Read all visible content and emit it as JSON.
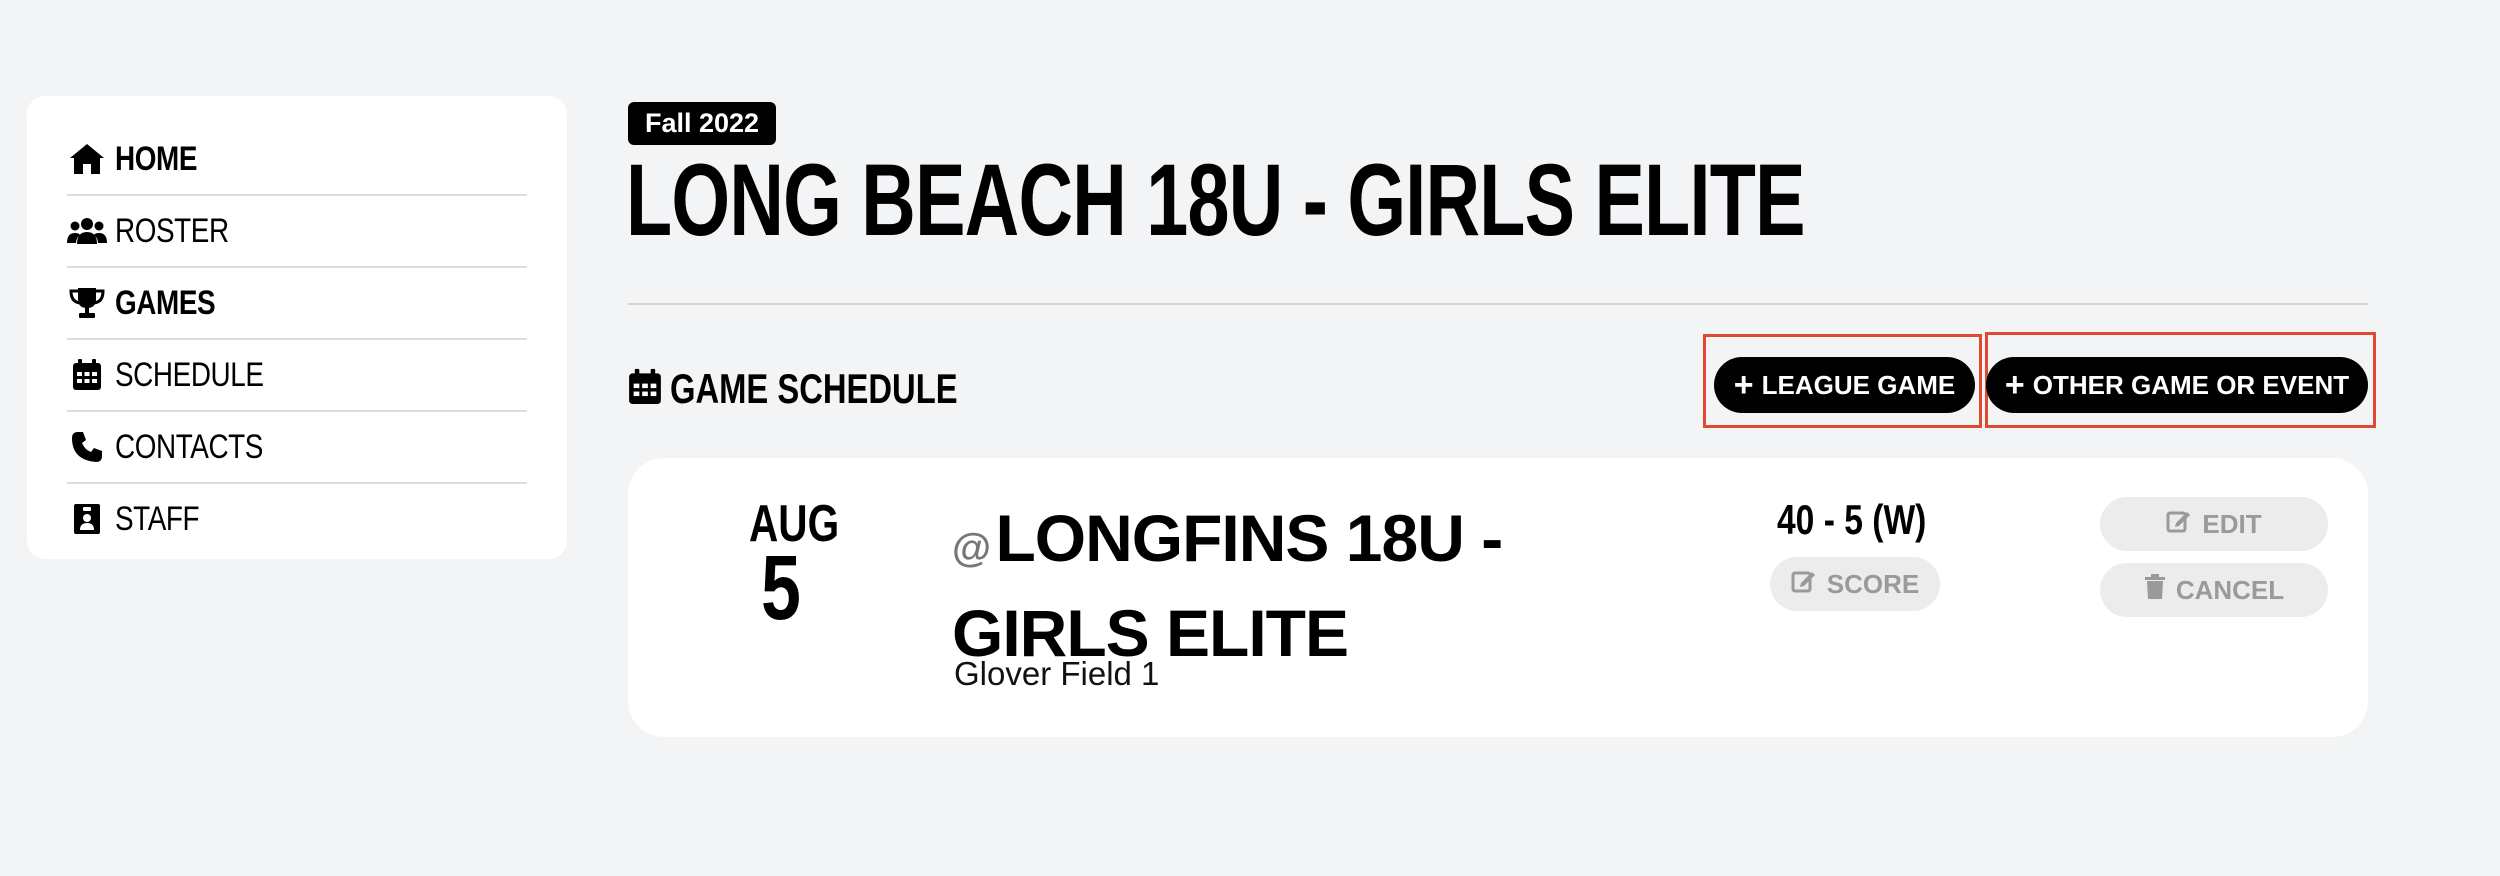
{
  "sidebar": {
    "items": [
      {
        "label": "HOME",
        "icon": "home-icon",
        "bold": true
      },
      {
        "label": "ROSTER",
        "icon": "users-icon",
        "bold": false
      },
      {
        "label": "GAMES",
        "icon": "trophy-icon",
        "bold": true
      },
      {
        "label": "SCHEDULE",
        "icon": "calendar-icon",
        "bold": false
      },
      {
        "label": "CONTACTS",
        "icon": "phone-icon",
        "bold": false
      },
      {
        "label": "STAFF",
        "icon": "id-badge-icon",
        "bold": false
      }
    ]
  },
  "header": {
    "season": "Fall 2022",
    "title": "LONG BEACH 18U - GIRLS ELITE"
  },
  "schedule": {
    "heading": "GAME SCHEDULE",
    "add_league_game": "LEAGUE GAME",
    "add_other_event": "OTHER GAME OR EVENT"
  },
  "game": {
    "month": "AUG",
    "day": "5",
    "at_symbol": "@",
    "opponent": "LONGFINS 18U - GIRLS ELITE",
    "venue": "Glover Field 1",
    "score": "40 - 5 (W)",
    "score_button": "SCORE",
    "edit_button": "EDIT",
    "cancel_button": "CANCEL"
  },
  "colors": {
    "highlight": "#e04a33",
    "background": "#f3f4f6"
  }
}
